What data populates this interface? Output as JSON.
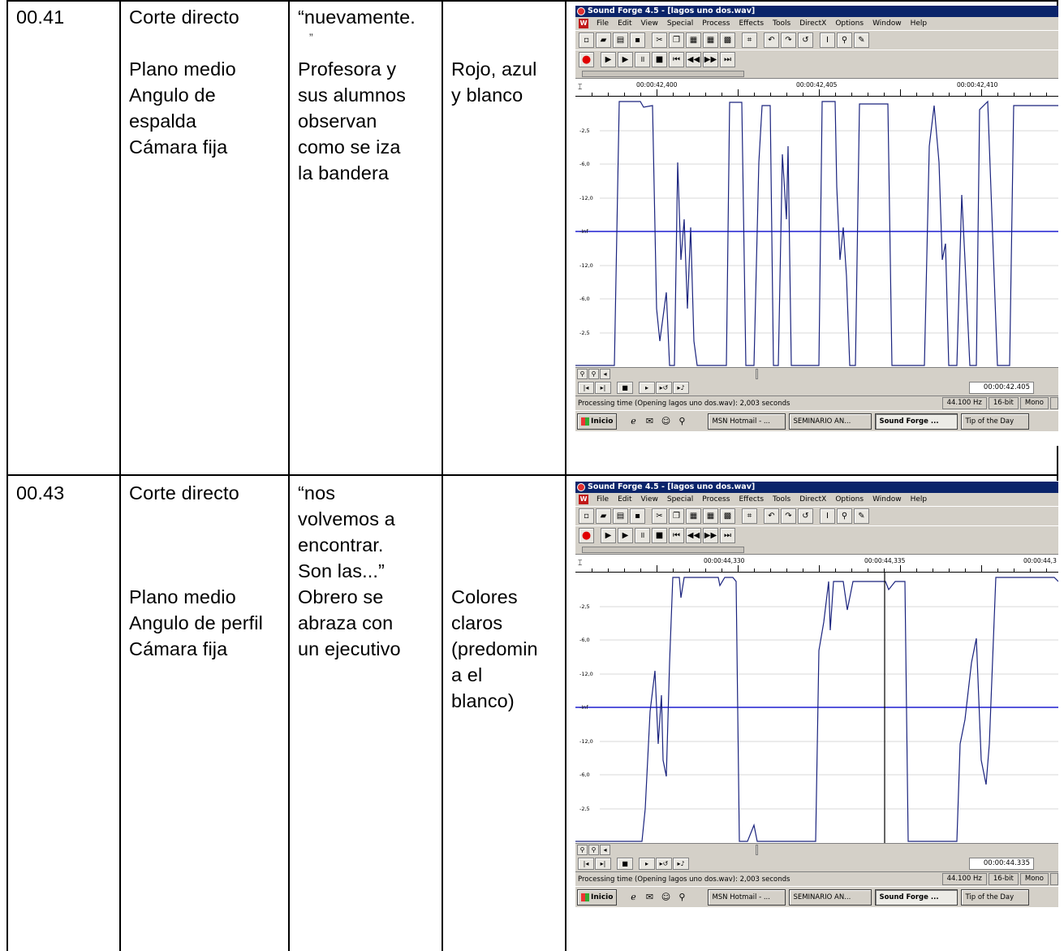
{
  "table": {
    "rows": [
      {
        "time": "00.41",
        "transition": "Corte directo",
        "shot": "Plano medio\nAngulo de\nespalda\nCámara fija",
        "audio_quote": "“nuevamente.",
        "audio_mark": "”",
        "description": "Profesora y\nsus alumnos\nobservan\ncomo se iza\nla bandera",
        "color": "Rojo, azul\ny blanco"
      },
      {
        "time": "00.43",
        "transition": "Corte directo",
        "shot": "Plano medio\nAngulo de perfil\nCámara fija",
        "audio_quote": "“nos\nvolvemos a\nencontrar.\nSon las...”",
        "description": "Obrero se\nabraza con\nun ejecutivo",
        "color": "Colores\nclaros\n(predomin\na el\nblanco)"
      }
    ]
  },
  "sound_forge": {
    "window_title": "Sound Forge 4.5 - [lagos uno dos.wav]",
    "menu": [
      "File",
      "Edit",
      "View",
      "Special",
      "Process",
      "Effects",
      "Tools",
      "DirectX",
      "Options",
      "Window",
      "Help"
    ],
    "y_axis_labels": [
      "-2,5",
      "-6,0",
      "-12,0",
      "-Inf",
      "-12,0",
      "-6,0",
      "-2,5"
    ],
    "status_text": "Processing time (Opening lagos uno dos.wav): 2,003 seconds",
    "sample_rate": "44.100 Hz",
    "bit_depth": "16-bit",
    "channels": "Mono",
    "taskbar": {
      "start": "Inicio",
      "tasks": [
        "MSN Hotmail - ...",
        "SEMINARIO AN...",
        "Sound Forge ...",
        "Tip of the Day"
      ]
    },
    "waveform_color": "#1a237e",
    "center_line_color": "#1f1fd0",
    "screens": [
      {
        "ruler_labels": [
          "00:00:42,400",
          "00:00:42,405",
          "00:00:42,410"
        ],
        "time_display": "00:00:42.405"
      },
      {
        "ruler_labels": [
          "00:00:44,330",
          "00:00:44,335",
          "00:00:44,3"
        ],
        "time_display": "00:00:44.335"
      }
    ]
  }
}
